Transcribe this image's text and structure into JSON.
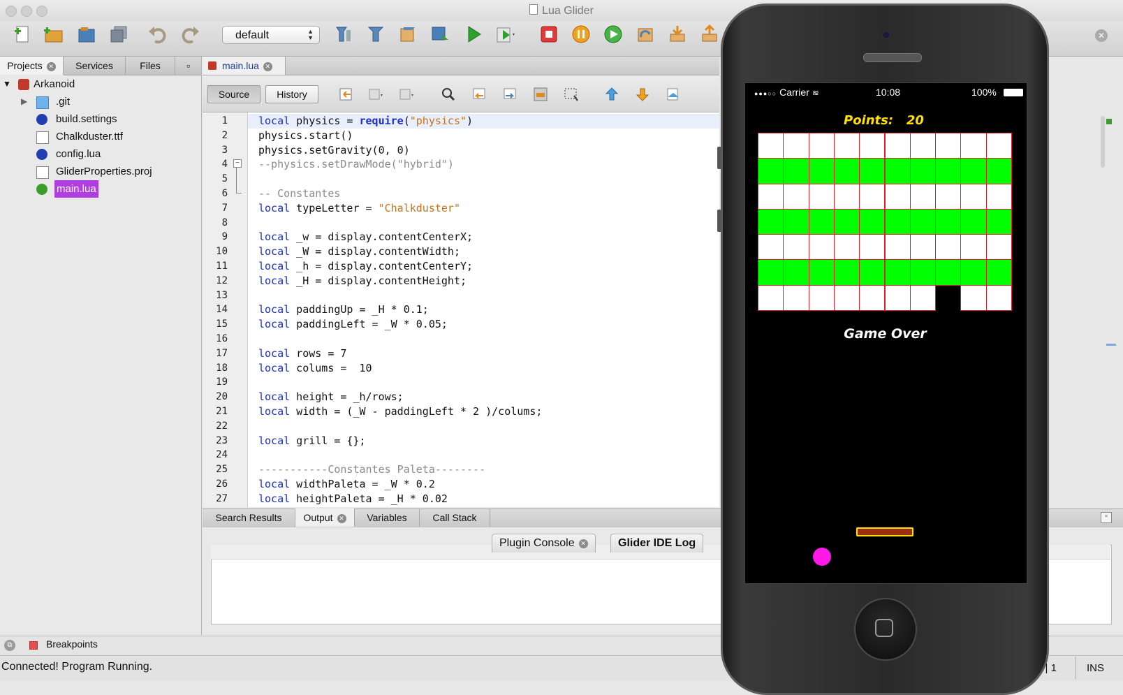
{
  "window": {
    "title": "Lua Glider"
  },
  "toolbar": {
    "config_value": "default",
    "icons": [
      "new-file-icon",
      "new-project-icon",
      "open-project-icon",
      "save-all-icon",
      "undo-icon",
      "redo-icon",
      "clean-build-icon",
      "build-icon",
      "run-config-icon",
      "debug-icon",
      "run-icon",
      "run-menu-icon",
      "stop-icon",
      "pause-icon",
      "continue-icon",
      "step-over-icon",
      "step-into-icon",
      "step-out-icon"
    ]
  },
  "left_panel": {
    "tabs": [
      "Projects",
      "Services",
      "Files"
    ],
    "tree": {
      "project": "Arkanoid",
      "items": [
        ".git",
        "build.settings",
        "Chalkduster.ttf",
        "config.lua",
        "GliderProperties.proj",
        "main.lua"
      ]
    }
  },
  "editor": {
    "tab": "main.lua",
    "source_label": "Source",
    "history_label": "History",
    "lines": [
      {
        "n": "1",
        "t": "local physics = require(\"physics\")"
      },
      {
        "n": "2",
        "t": "physics.start()"
      },
      {
        "n": "3",
        "t": "physics.setGravity(0, 0)"
      },
      {
        "n": "4",
        "t": "--physics.setDrawMode(\"hybrid\")"
      },
      {
        "n": "5",
        "t": ""
      },
      {
        "n": "6",
        "t": "-- Constantes"
      },
      {
        "n": "7",
        "t": "local typeLetter = \"Chalkduster\""
      },
      {
        "n": "8",
        "t": ""
      },
      {
        "n": "9",
        "t": "local _w = display.contentCenterX;"
      },
      {
        "n": "10",
        "t": "local _W = display.contentWidth;"
      },
      {
        "n": "11",
        "t": "local _h = display.contentCenterY;"
      },
      {
        "n": "12",
        "t": "local _H = display.contentHeight;"
      },
      {
        "n": "13",
        "t": ""
      },
      {
        "n": "14",
        "t": "local paddingUp = _H * 0.1;"
      },
      {
        "n": "15",
        "t": "local paddingLeft = _W * 0.05;"
      },
      {
        "n": "16",
        "t": ""
      },
      {
        "n": "17",
        "t": "local rows = 7"
      },
      {
        "n": "18",
        "t": "local colums =  10"
      },
      {
        "n": "19",
        "t": ""
      },
      {
        "n": "20",
        "t": "local height = _h/rows;"
      },
      {
        "n": "21",
        "t": "local width = (_W - paddingLeft * 2 )/colums;"
      },
      {
        "n": "22",
        "t": ""
      },
      {
        "n": "23",
        "t": "local grill = {};"
      },
      {
        "n": "24",
        "t": ""
      },
      {
        "n": "25",
        "t": "-----------Constantes Paleta--------"
      },
      {
        "n": "26",
        "t": "local widthPaleta = _W * 0.2"
      },
      {
        "n": "27",
        "t": "local heightPaleta = _H * 0.02"
      }
    ]
  },
  "output": {
    "tabs": [
      "Search Results",
      "Output",
      "Variables",
      "Call Stack"
    ],
    "console_tabs": [
      "Plugin Console",
      "Glider IDE Log"
    ]
  },
  "breakpoints_label": "Breakpoints",
  "status": {
    "text": "Connected! Program Running.",
    "position": "1 | 1",
    "mode": "INS"
  },
  "phone": {
    "carrier": "Carrier",
    "time": "10:08",
    "battery": "100%",
    "points_label": "Points:",
    "points_value": "20",
    "game_over": "Game Over",
    "grid": {
      "rows": 7,
      "cols": 10,
      "row_colors": [
        "white",
        "green",
        "white",
        "green",
        "white",
        "green",
        "white"
      ],
      "missing": [
        [
          6,
          7
        ]
      ]
    },
    "colors": {
      "green": "#00ff00",
      "white": "#ffffff",
      "border": "#e0202a",
      "points": "#ffe000",
      "ball": "#ff19e6"
    }
  }
}
